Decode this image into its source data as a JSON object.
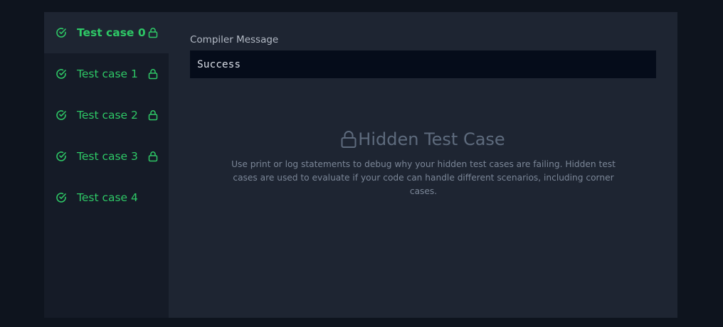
{
  "test_cases": [
    {
      "label": "Test case 0",
      "status": "passed",
      "locked": true,
      "active": true
    },
    {
      "label": "Test case 1",
      "status": "passed",
      "locked": true,
      "active": false
    },
    {
      "label": "Test case 2",
      "status": "passed",
      "locked": true,
      "active": false
    },
    {
      "label": "Test case 3",
      "status": "passed",
      "locked": true,
      "active": false
    },
    {
      "label": "Test case 4",
      "status": "passed",
      "locked": false,
      "active": false
    }
  ],
  "compiler": {
    "label": "Compiler Message",
    "message": "Success"
  },
  "hidden": {
    "title": "Hidden Test Case",
    "description": "Use print or log statements to debug why your hidden test cases are failing. Hidden test cases are used to evaluate if your code can handle different scenarios, including corner cases."
  },
  "colors": {
    "success": "#2ec866",
    "background": "#0e141e",
    "panel": "#1e2532",
    "sidebar": "#151b27"
  },
  "icons": {
    "status": "check-circle-icon",
    "locked": "lock-icon"
  }
}
